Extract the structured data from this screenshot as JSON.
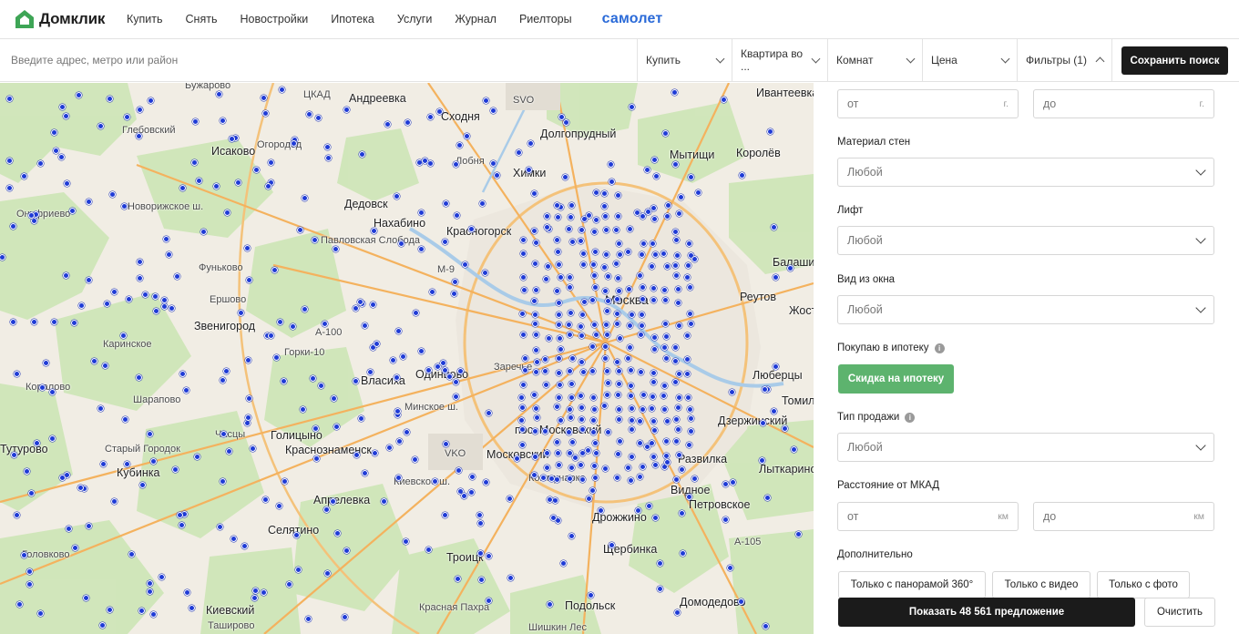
{
  "brand": {
    "name": "Домклик",
    "partner": "самолет",
    "accent": "#2a6ad8",
    "logo_color": "#3ea556"
  },
  "nav": {
    "items": [
      "Купить",
      "Снять",
      "Новостройки",
      "Ипотека",
      "Услуги",
      "Журнал",
      "Риелторы"
    ]
  },
  "search": {
    "placeholder": "Введите адрес, метро или район",
    "deal": "Купить",
    "property": "Квартира во ...",
    "rooms": "Комнат",
    "price": "Цена",
    "filters": "Фильтры (1)",
    "save_label": "Сохранить поиск"
  },
  "map": {
    "labels": [
      "Бужарово",
      "Глебовский",
      "Исаково",
      "Огородод",
      "Онуфриево",
      "Новорижское ш.",
      "ЦКАД",
      "Андреевка",
      "Сходня",
      "Дедовск",
      "Нахабино",
      "Красногорск",
      "Павловская Слобода",
      "Химки",
      "Долгопрудный",
      "Мытищи",
      "Королёв",
      "Ивантеевка",
      "Фуньково",
      "Ершово",
      "Звенигород",
      "Горки-10",
      "Каринское",
      "Коралово",
      "Москва",
      "Балашиха",
      "Реутов",
      "Власиха",
      "Одинцово",
      "Заречье",
      "Люберцы",
      "Шарапово",
      "Часцы",
      "Голицыно",
      "Краснознаменск",
      "пос. Московский",
      "Московский",
      "Дзержинский",
      "Тутурово",
      "Старый Городок",
      "Кубинка",
      "Апрелевка",
      "Коммунарка",
      "Развилка",
      "Лыткарино",
      "Видное",
      "Петровское",
      "Селятино",
      "Троицк",
      "Дрожжино",
      "Щербинка",
      "Головково",
      "Киевское ш.",
      "Минское ш.",
      "Подольск",
      "Домодедово",
      "Красная Пахра",
      "Киевский",
      "Ташировo",
      "Шишкин Лес",
      "Томилино",
      "Жостово",
      "SVO",
      "VKO",
      "М-9",
      "А-105",
      "А-100",
      "Лобня"
    ]
  },
  "filters": {
    "year_from": "от",
    "year_to": "до",
    "year_unit": "г.",
    "walls_label": "Материал стен",
    "walls_value": "Любой",
    "lift_label": "Лифт",
    "lift_value": "Любой",
    "view_label": "Вид из окна",
    "view_value": "Любой",
    "mortgage_label": "Покупаю в ипотеку",
    "mortgage_button": "Скидка на ипотеку",
    "sale_type_label": "Тип продажи",
    "sale_type_value": "Любой",
    "distance_label": "Расстояние от МКАД",
    "distance_from": "от",
    "distance_to": "до",
    "distance_unit": "км",
    "extra_label": "Дополнительно",
    "chips": [
      "Только с панорамой 360°",
      "Только с видео",
      "Только с фото"
    ],
    "show_button": "Показать 48 561 предложение",
    "clear_button": "Очистить",
    "info_icon": "i"
  }
}
